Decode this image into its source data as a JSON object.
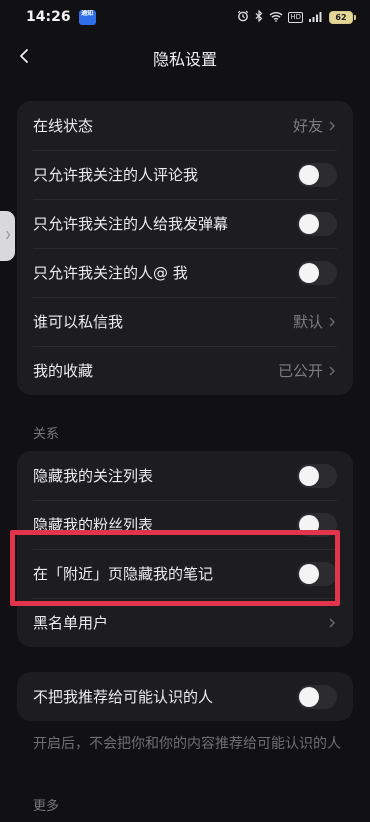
{
  "status_bar": {
    "time": "14:26",
    "notification_badge": "通知",
    "icons": [
      "alarm-icon",
      "bluetooth-icon",
      "wifi-icon",
      "hd-icon",
      "signal-icon",
      "battery-icon"
    ],
    "hd_label": "HD",
    "battery": "62"
  },
  "nav": {
    "title": "隐私设置",
    "back_icon": "chevron-left-icon"
  },
  "group1": [
    {
      "label": "在线状态",
      "type": "link",
      "value": "好友"
    },
    {
      "label": "只允许我关注的人评论我",
      "type": "toggle",
      "on": false
    },
    {
      "label": "只允许我关注的人给我发弹幕",
      "type": "toggle",
      "on": false
    },
    {
      "label": "只允许我关注的人@ 我",
      "type": "toggle",
      "on": false
    },
    {
      "label": "谁可以私信我",
      "type": "link",
      "value": "默认"
    },
    {
      "label": "我的收藏",
      "type": "link",
      "value": "已公开"
    }
  ],
  "section_relations": "关系",
  "group2": [
    {
      "label": "隐藏我的关注列表",
      "type": "toggle",
      "on": false
    },
    {
      "label": "隐藏我的粉丝列表",
      "type": "toggle",
      "on": false
    },
    {
      "label": "在「附近」页隐藏我的笔记",
      "type": "toggle",
      "on": false
    },
    {
      "label": "黑名单用户",
      "type": "link",
      "value": ""
    }
  ],
  "group3": [
    {
      "label": "不把我推荐给可能认识的人",
      "type": "toggle",
      "on": false
    }
  ],
  "recommend_desc": "开启后，不会把你和你的内容推荐给可能认识的人",
  "section_more": "更多",
  "colors": {
    "background": "#111113",
    "card": "#1d1d20",
    "highlight": "#e2344b",
    "battery": "#e3d696"
  }
}
